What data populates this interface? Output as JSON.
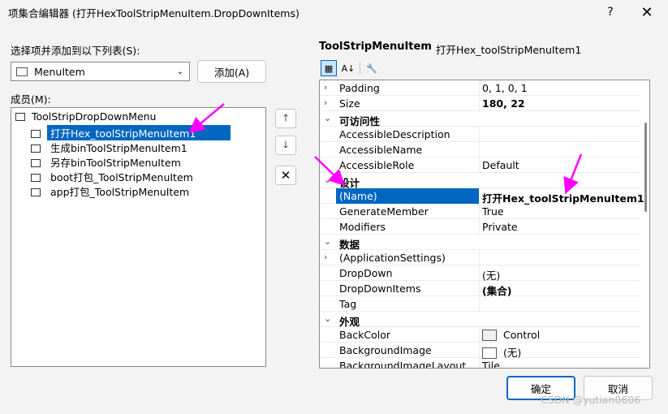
{
  "window": {
    "title": "项集合编辑器 (打开HexToolStripMenuItem.DropDownItems)",
    "help": "?",
    "close": "✕"
  },
  "left": {
    "select_label": "选择项并添加到以下列表(S):",
    "combo_value": "MenuItem",
    "add_button": "添加(A)",
    "members_label": "成员(M):",
    "tree": [
      {
        "label": "ToolStripDropDownMenu"
      },
      {
        "label": "打开Hex_toolStripMenuItem1",
        "selected": true
      },
      {
        "label": "生成binToolStripMenuItem1"
      },
      {
        "label": "另存binToolStripMenuItem"
      },
      {
        "label": "boot打包_ToolStripMenuItem"
      },
      {
        "label": "app打包_ToolStripMenuItem"
      }
    ]
  },
  "side_buttons": {
    "up": "🡑",
    "down": "🡓",
    "delete": "✕"
  },
  "properties": {
    "type_name": "ToolStripMenuItem",
    "object_name": "打开Hex_toolStripMenuItem1",
    "toolbar": [
      "categorized-icon",
      "alphabetical-icon",
      "property-pages-icon"
    ],
    "rows": [
      {
        "type": "prop",
        "expand": "›",
        "name": "Padding",
        "value": "0, 1, 0, 1"
      },
      {
        "type": "prop",
        "expand": "›",
        "name": "Size",
        "value": "180, 22",
        "bold": true
      },
      {
        "type": "cat",
        "expand": "⌄",
        "name": "可访问性"
      },
      {
        "type": "prop",
        "name": "AccessibleDescription",
        "value": ""
      },
      {
        "type": "prop",
        "name": "AccessibleName",
        "value": ""
      },
      {
        "type": "prop",
        "name": "AccessibleRole",
        "value": "Default"
      },
      {
        "type": "cat",
        "expand": "⌄",
        "name": "设计"
      },
      {
        "type": "prop",
        "name": "(Name)",
        "value": "打开Hex_toolStripMenuItem1",
        "bold": true,
        "selected": true
      },
      {
        "type": "prop",
        "name": "GenerateMember",
        "value": "True"
      },
      {
        "type": "prop",
        "name": "Modifiers",
        "value": "Private"
      },
      {
        "type": "cat",
        "expand": "⌄",
        "name": "数据"
      },
      {
        "type": "prop",
        "expand": "›",
        "name": "(ApplicationSettings)",
        "value": ""
      },
      {
        "type": "prop",
        "name": "DropDown",
        "value": "(无)"
      },
      {
        "type": "prop",
        "name": "DropDownItems",
        "value": "(集合)",
        "bold": true
      },
      {
        "type": "prop",
        "name": "Tag",
        "value": ""
      },
      {
        "type": "cat",
        "expand": "⌄",
        "name": "外观"
      },
      {
        "type": "prop",
        "name": "BackColor",
        "value": "Control",
        "swatch": "#f0f0f0"
      },
      {
        "type": "prop",
        "name": "BackgroundImage",
        "value": "(无)",
        "swatch": "#ffffff"
      },
      {
        "type": "prop",
        "name": "BackgroundImageLayout",
        "value": "Tile"
      }
    ]
  },
  "footer": {
    "ok": "确定",
    "cancel": "取消"
  },
  "watermark": "CSDN @yutian0606",
  "colors": {
    "accent": "#0067c0",
    "annotation": "#ff00ff"
  }
}
